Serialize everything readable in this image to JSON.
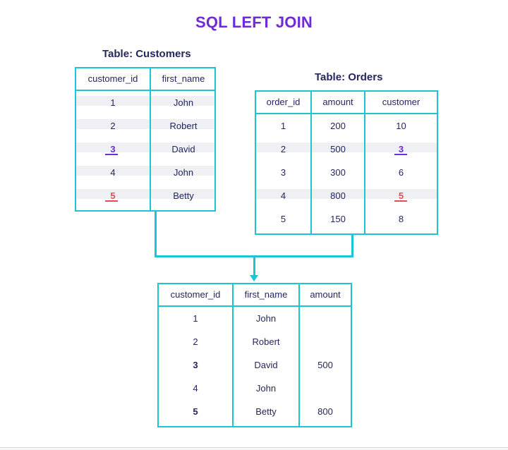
{
  "title": "SQL LEFT JOIN",
  "colors": {
    "title": "#6f2bd6",
    "border": "#1bc5d4",
    "highlight_purple": "#6f2bd6",
    "highlight_red": "#e24d4d"
  },
  "customers": {
    "caption": "Table: Customers",
    "columns": [
      "customer_id",
      "first_name"
    ],
    "rows": [
      [
        "1",
        "John"
      ],
      [
        "2",
        "Robert"
      ],
      [
        "3",
        "David"
      ],
      [
        "4",
        "John"
      ],
      [
        "5",
        "Betty"
      ]
    ]
  },
  "orders": {
    "caption": "Table: Orders",
    "columns": [
      "order_id",
      "amount",
      "customer"
    ],
    "rows": [
      [
        "1",
        "200",
        "10"
      ],
      [
        "2",
        "500",
        "3"
      ],
      [
        "3",
        "300",
        "6"
      ],
      [
        "4",
        "800",
        "5"
      ],
      [
        "5",
        "150",
        "8"
      ]
    ]
  },
  "result": {
    "columns": [
      "customer_id",
      "first_name",
      "amount"
    ],
    "rows": [
      [
        "1",
        "John",
        ""
      ],
      [
        "2",
        "Robert",
        ""
      ],
      [
        "3",
        "David",
        "500"
      ],
      [
        "4",
        "John",
        ""
      ],
      [
        "5",
        "Betty",
        "800"
      ]
    ]
  }
}
